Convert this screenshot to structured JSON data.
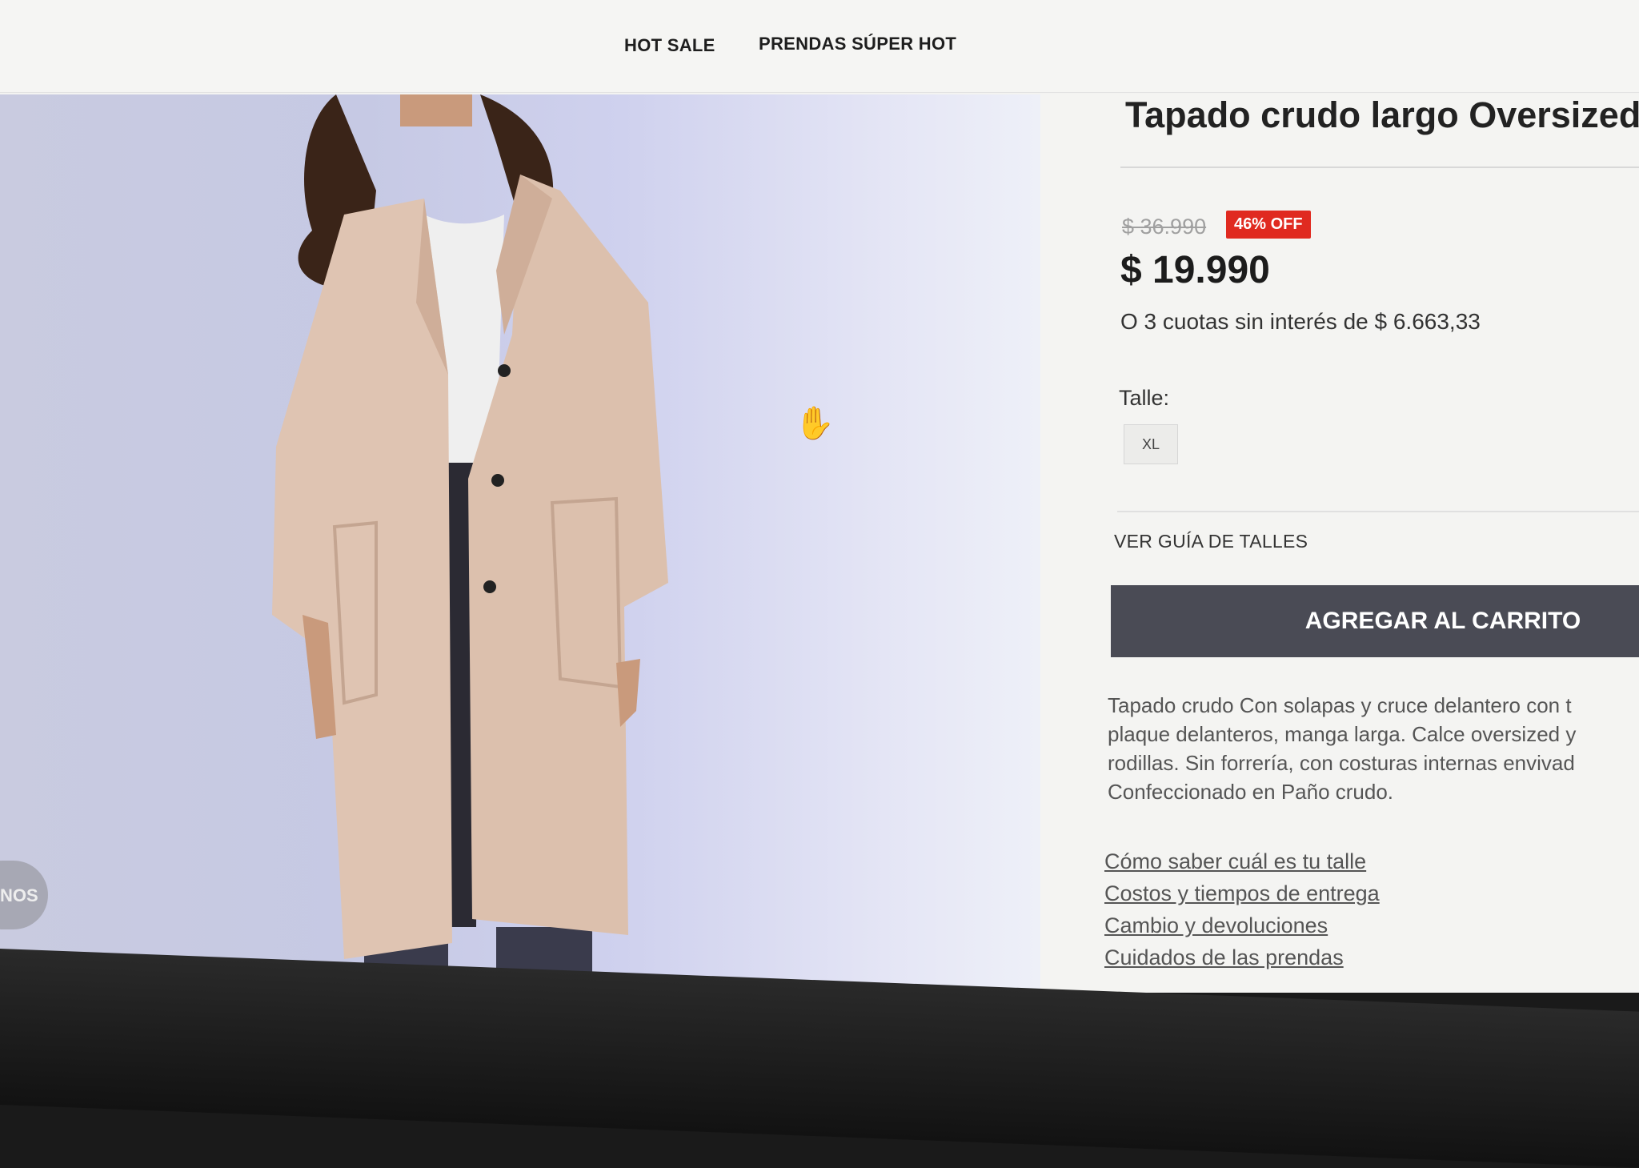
{
  "nav": {
    "items": [
      {
        "label": "HOT SALE"
      },
      {
        "label": "PRENDAS SÚPER HOT"
      }
    ]
  },
  "floating": {
    "whatsapp_text": "NOS"
  },
  "product": {
    "title": "Tapado crudo largo Oversized",
    "old_price": "$ 36.990",
    "discount_badge": "46% OFF",
    "price": "$ 19.990",
    "installments": "O 3 cuotas sin interés de $ 6.663,33",
    "size_label": "Talle:",
    "sizes": [
      {
        "label": "XL",
        "selected": true
      }
    ],
    "size_guide_label": "VER GUÍA DE TALLES",
    "add_to_cart_label": "AGREGAR AL CARRITO",
    "description": "Tapado crudo Con solapas y cruce delantero con t\nplaque delanteros, manga larga. Calce oversized y\nrodillas. Sin forrería, con costuras internas envivad\nConfeccionado en Paño crudo.",
    "info_links": [
      {
        "label": "Cómo saber cuál es tu talle"
      },
      {
        "label": "Costos y tiempos de entrega"
      },
      {
        "label": "Cambio y devoluciones"
      },
      {
        "label": "Cuidados de las prendas"
      }
    ]
  },
  "colors": {
    "badge": "#e02a20",
    "cart_button": "#4a4b55"
  },
  "icons": {
    "cursor": "hand-pointer-icon"
  }
}
